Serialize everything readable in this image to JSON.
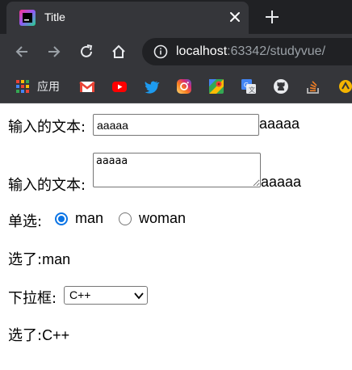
{
  "browser": {
    "tab_title": "Title",
    "url_host": "localhost",
    "url_rest": ":63342/studyvue/",
    "bookmarks_label": "应用"
  },
  "form": {
    "text_label": "输入的文本:",
    "text_value": "aaaaa",
    "text_echo": "aaaaa",
    "textarea_label": "输入的文本:",
    "textarea_value": "aaaaa",
    "textarea_echo": "aaaaa",
    "radio_label": "单选:",
    "radio_options": [
      "man",
      "woman"
    ],
    "radio_selected": "man",
    "radio_result_prefix": "选了:",
    "radio_result": "man",
    "select_label": "下拉框:",
    "select_value": "C++",
    "select_result_prefix": "选了:",
    "select_result": "C++"
  },
  "colors": {
    "accent": "#0b74e5"
  }
}
